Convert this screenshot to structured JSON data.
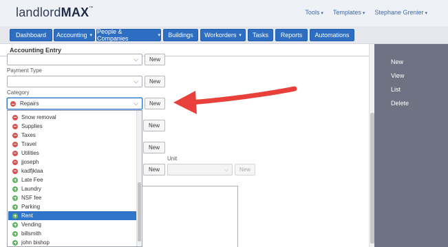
{
  "header": {
    "logo_prefix": "landlord",
    "logo_bold": "MAX",
    "logo_tm": "™",
    "topnav": [
      {
        "label": "Tools"
      },
      {
        "label": "Templates"
      },
      {
        "label": "Stephane Grenier"
      }
    ]
  },
  "mainnav": [
    {
      "label": "Dashboard",
      "has_caret": false
    },
    {
      "label": "Accounting",
      "has_caret": true
    },
    {
      "label": "People & Companies",
      "has_caret": true
    },
    {
      "label": "Buildings",
      "has_caret": false
    },
    {
      "label": "Workorders",
      "has_caret": true
    },
    {
      "label": "Tasks",
      "has_caret": false
    },
    {
      "label": "Reports",
      "has_caret": false
    },
    {
      "label": "Automations",
      "has_caret": false
    }
  ],
  "content": {
    "title": "Accounting Entry",
    "payment_type_label": "Payment Type",
    "category_label": "Category",
    "category_value": "Repairs",
    "unit_label": "Unit",
    "new_label": "New"
  },
  "dropdown": {
    "items": [
      {
        "label": "Snow removal",
        "type": "expense"
      },
      {
        "label": "Supplies",
        "type": "expense"
      },
      {
        "label": "Taxes",
        "type": "expense"
      },
      {
        "label": "Travel",
        "type": "expense"
      },
      {
        "label": "Utilities",
        "type": "expense"
      },
      {
        "label": "jjoseph",
        "type": "expense"
      },
      {
        "label": "kadfjklaa",
        "type": "expense"
      },
      {
        "label": "Late Fee",
        "type": "income"
      },
      {
        "label": "Laundry",
        "type": "income"
      },
      {
        "label": "NSF fee",
        "type": "income"
      },
      {
        "label": "Parking",
        "type": "income"
      },
      {
        "label": "Rent",
        "type": "income",
        "selected": true
      },
      {
        "label": "Vending",
        "type": "income"
      },
      {
        "label": "billsmith",
        "type": "income"
      },
      {
        "label": "john bishop",
        "type": "income"
      }
    ]
  },
  "sidebar": {
    "items": [
      {
        "label": "New"
      },
      {
        "label": "View"
      },
      {
        "label": "List"
      },
      {
        "label": "Delete"
      }
    ]
  },
  "colors": {
    "nav_blue": "#2d6dc2",
    "sidebar_gray": "#6e7283",
    "arrow_red": "#e8413c",
    "expense_red": "#d9534f",
    "income_green": "#5cb85c",
    "selected_blue": "#2f74c8"
  },
  "icons": {
    "expense": "minus-circle-icon",
    "income": "plus-circle-icon",
    "chevron": "chevron-down-icon"
  }
}
